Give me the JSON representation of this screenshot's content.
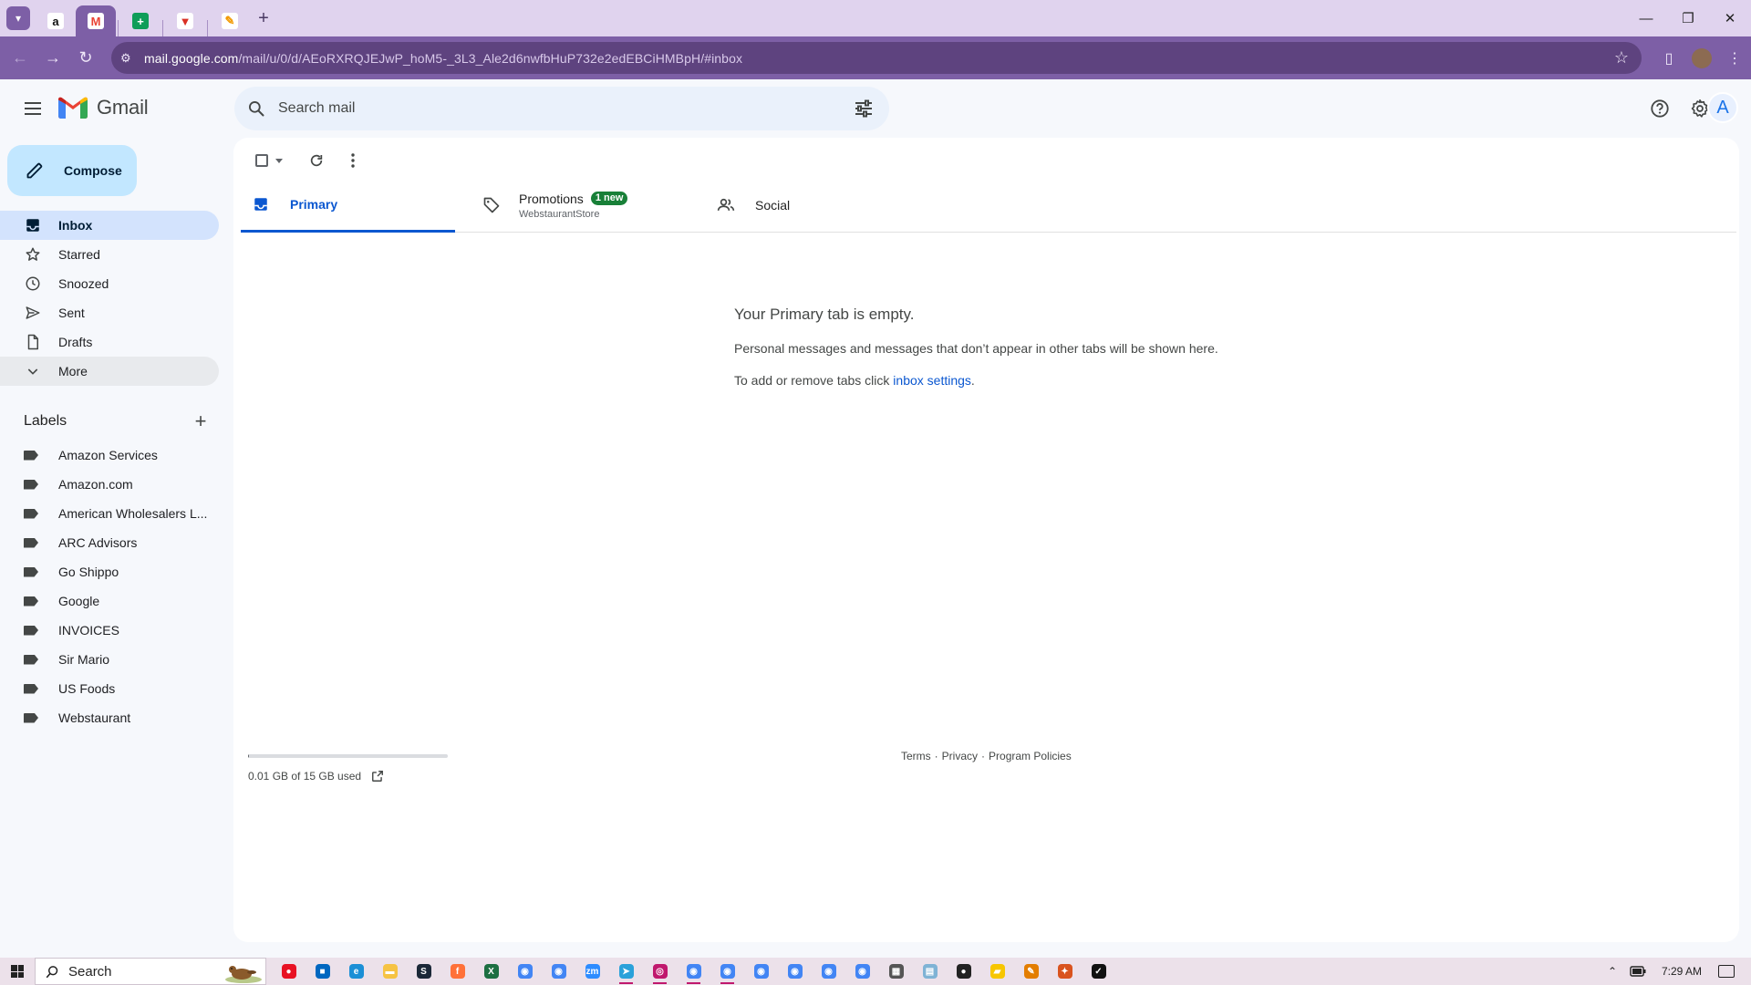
{
  "browser": {
    "tabs": [
      {
        "icon": "amazon-icon",
        "glyph": "a",
        "bg": "#ffffff",
        "fg": "#111111"
      },
      {
        "icon": "gmail-icon",
        "glyph": "M",
        "bg": "#ffffff",
        "fg": "#ea4335",
        "active": true
      },
      {
        "icon": "sheets-icon",
        "glyph": "+",
        "bg": "#0f9d58",
        "fg": "#ffffff"
      },
      {
        "icon": "shopify-icon",
        "glyph": "▼",
        "bg": "#ffffff",
        "fg": "#d93025"
      },
      {
        "icon": "app-icon",
        "glyph": "✎",
        "bg": "#ffffff",
        "fg": "#f29900"
      }
    ],
    "url_host": "mail.google.com",
    "url_path": "/mail/u/0/d/AEoRXRQJEJwP_hoM5-_3L3_Ale2d6nwfbHuP732e2edEBCiHMBpH/#inbox"
  },
  "gmail": {
    "app_name": "Gmail",
    "search_placeholder": "Search mail",
    "account_initial": "A",
    "compose_label": "Compose",
    "nav": [
      {
        "label": "Inbox",
        "icon": "inbox-icon"
      },
      {
        "label": "Starred",
        "icon": "star-icon"
      },
      {
        "label": "Snoozed",
        "icon": "clock-icon"
      },
      {
        "label": "Sent",
        "icon": "send-icon"
      },
      {
        "label": "Drafts",
        "icon": "draft-icon"
      },
      {
        "label": "More",
        "icon": "chevron-down-icon"
      }
    ],
    "labels_title": "Labels",
    "labels": [
      "Amazon Services",
      "Amazon.com",
      "American Wholesalers L...",
      "ARC Advisors",
      "Go Shippo",
      "Google",
      "INVOICES",
      "Sir Mario",
      "US Foods",
      "Webstaurant"
    ],
    "tabs": {
      "primary": "Primary",
      "promotions": "Promotions",
      "promotions_badge": "1 new",
      "promotions_sub": "WebstaurantStore",
      "social": "Social"
    },
    "empty": {
      "heading": "Your Primary tab is empty.",
      "line1": "Personal messages and messages that don’t appear in other tabs will be shown here.",
      "line2_prefix": "To add or remove tabs click ",
      "line2_link": "inbox settings",
      "line2_suffix": "."
    },
    "storage": {
      "text": "0.01 GB of 15 GB used",
      "fraction_used": 0.001
    },
    "footer": {
      "terms": "Terms",
      "sep": "·",
      "privacy": "Privacy",
      "policies": "Program Policies"
    }
  },
  "taskbar": {
    "search_label": "Search",
    "clock": "7:29 AM",
    "apps": [
      {
        "name": "app-red-icon",
        "color": "#e81123",
        "glyph": "●"
      },
      {
        "name": "store-icon",
        "color": "#0067c0",
        "glyph": "■"
      },
      {
        "name": "edge-icon",
        "color": "#1b8fd6",
        "glyph": "e"
      },
      {
        "name": "file-explorer-icon",
        "color": "#f6c343",
        "glyph": "▬"
      },
      {
        "name": "steam-icon",
        "color": "#1b2838",
        "glyph": "S"
      },
      {
        "name": "firefox-icon",
        "color": "#ff7139",
        "glyph": "f"
      },
      {
        "name": "excel-icon",
        "color": "#1d6f42",
        "glyph": "X"
      },
      {
        "name": "chrome-icon",
        "color": "#4285f4",
        "glyph": "◉"
      },
      {
        "name": "chrome-icon",
        "color": "#4285f4",
        "glyph": "◉"
      },
      {
        "name": "zoom-icon",
        "color": "#2d8cff",
        "glyph": "zm"
      },
      {
        "name": "telegram-icon",
        "color": "#2aa1da",
        "glyph": "➤",
        "running": true
      },
      {
        "name": "app-pink-icon",
        "color": "#c0186d",
        "glyph": "◎",
        "running": true
      },
      {
        "name": "chrome-icon",
        "color": "#4285f4",
        "glyph": "◉",
        "running": true
      },
      {
        "name": "chrome-icon",
        "color": "#4285f4",
        "glyph": "◉",
        "running": true
      },
      {
        "name": "chrome-icon",
        "color": "#4285f4",
        "glyph": "◉"
      },
      {
        "name": "chrome-icon",
        "color": "#4285f4",
        "glyph": "◉"
      },
      {
        "name": "chrome-icon",
        "color": "#4285f4",
        "glyph": "◉"
      },
      {
        "name": "chrome-icon",
        "color": "#4285f4",
        "glyph": "◉"
      },
      {
        "name": "calculator-icon",
        "color": "#555555",
        "glyph": "▦"
      },
      {
        "name": "notepad-icon",
        "color": "#7fb3d5",
        "glyph": "▤"
      },
      {
        "name": "obs-icon",
        "color": "#222222",
        "glyph": "●"
      },
      {
        "name": "sticky-notes-icon",
        "color": "#f7c600",
        "glyph": "▰"
      },
      {
        "name": "paint-icon",
        "color": "#e37d00",
        "glyph": "✎"
      },
      {
        "name": "app-orange-icon",
        "color": "#d9531e",
        "glyph": "✦"
      },
      {
        "name": "app-check-icon",
        "color": "#111111",
        "glyph": "✓"
      }
    ]
  }
}
